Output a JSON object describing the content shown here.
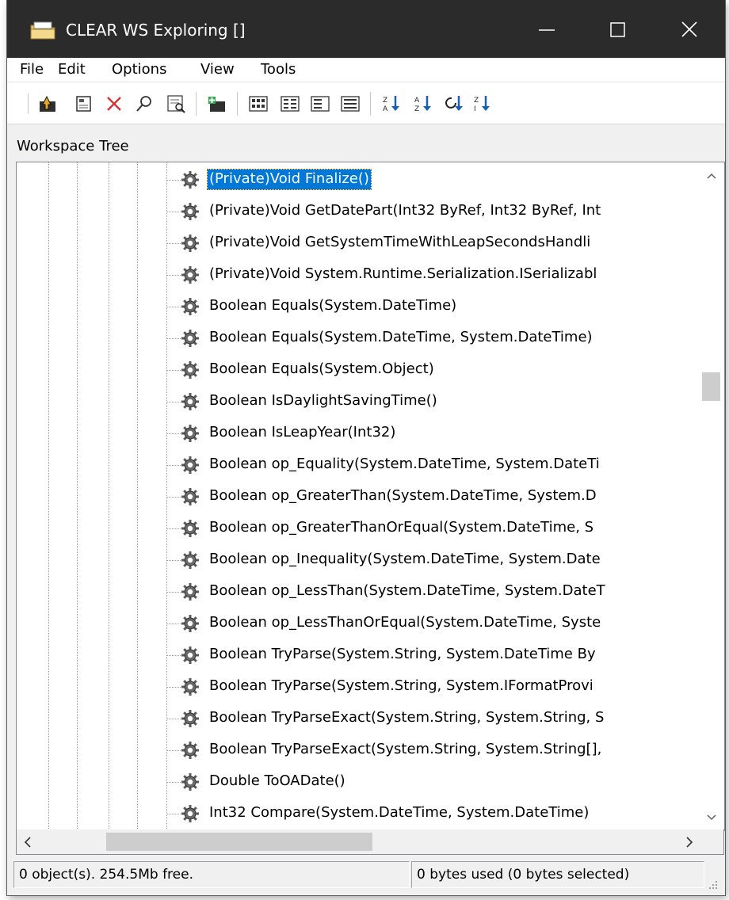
{
  "window": {
    "title": "CLEAR WS Exploring []",
    "title_bar_color": "#2b2b2b",
    "icons": [
      "app-icon",
      "minimize-icon",
      "maximize-icon",
      "close-icon"
    ]
  },
  "menu": {
    "items": [
      "File",
      "Edit",
      "Options",
      "View",
      "Tools"
    ]
  },
  "toolbar": {
    "buttons": [
      "up-folder-icon",
      "properties-icon",
      "delete-icon",
      "find-icon",
      "inspect-icon",
      "new-item-icon",
      "large-icons-view-icon",
      "small-icons-view-icon",
      "list-view-icon",
      "details-view-icon",
      "sort-descending-icon",
      "sort-ascending-icon",
      "refresh-icon",
      "sort-icon"
    ]
  },
  "panel": {
    "header": "Workspace Tree"
  },
  "tree": {
    "selected_index": 0,
    "selection_color": "#0078d7",
    "item_icon": "method-gear-icon",
    "items": [
      "(Private)Void Finalize()",
      "(Private)Void GetDatePart(Int32 ByRef, Int32 ByRef, Int",
      "(Private)Void GetSystemTimeWithLeapSecondsHandli",
      "(Private)Void System.Runtime.Serialization.ISerializabl",
      "Boolean Equals(System.DateTime)",
      "Boolean Equals(System.DateTime, System.DateTime)",
      "Boolean Equals(System.Object)",
      "Boolean IsDaylightSavingTime()",
      "Boolean IsLeapYear(Int32)",
      "Boolean op_Equality(System.DateTime, System.DateTi",
      "Boolean op_GreaterThan(System.DateTime, System.D",
      "Boolean op_GreaterThanOrEqual(System.DateTime, S",
      "Boolean op_Inequality(System.DateTime, System.Date",
      "Boolean op_LessThan(System.DateTime, System.DateT",
      "Boolean op_LessThanOrEqual(System.DateTime, Syste",
      "Boolean TryParse(System.String, System.DateTime By",
      "Boolean TryParse(System.String, System.IFormatProvi",
      "Boolean TryParseExact(System.String, System.String, S",
      "Boolean TryParseExact(System.String, System.String[],",
      "Double ToOADate()",
      "Int32 Compare(System.DateTime, System.DateTime)"
    ]
  },
  "scrollbars": {
    "vertical_position": 0.35,
    "horizontal_position": 0.15
  },
  "status": {
    "left": "0 object(s). 254.5Mb free.",
    "right": "0 bytes used (0 bytes selected)"
  }
}
